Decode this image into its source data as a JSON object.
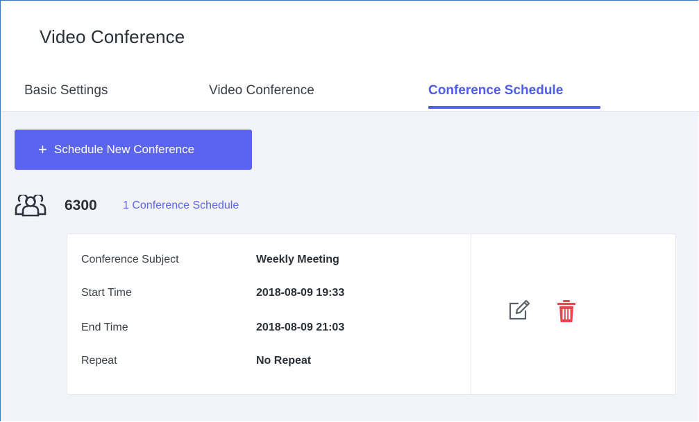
{
  "header": {
    "title": "Video Conference",
    "tabs": [
      {
        "label": "Basic Settings"
      },
      {
        "label": "Video Conference"
      },
      {
        "label": "Conference Schedule",
        "active": true
      }
    ]
  },
  "toolbar": {
    "new_button_label": "Schedule New Conference",
    "plus_glyph": "+"
  },
  "conference": {
    "extension": "6300",
    "schedule_count_text": "1 Conference Schedule",
    "icon": "group-icon",
    "details": [
      {
        "label": "Conference Subject",
        "value": "Weekly Meeting"
      },
      {
        "label": "Start Time",
        "value": "2018-08-09 19:33"
      },
      {
        "label": "End Time",
        "value": "2018-08-09 21:03"
      },
      {
        "label": "Repeat",
        "value": "No Repeat"
      }
    ],
    "actions": {
      "edit_icon": "edit-icon",
      "delete_icon": "trash-icon"
    }
  },
  "colors": {
    "accent": "#5b64ee",
    "delete": "#f0444e",
    "background": "#f1f3f8"
  }
}
